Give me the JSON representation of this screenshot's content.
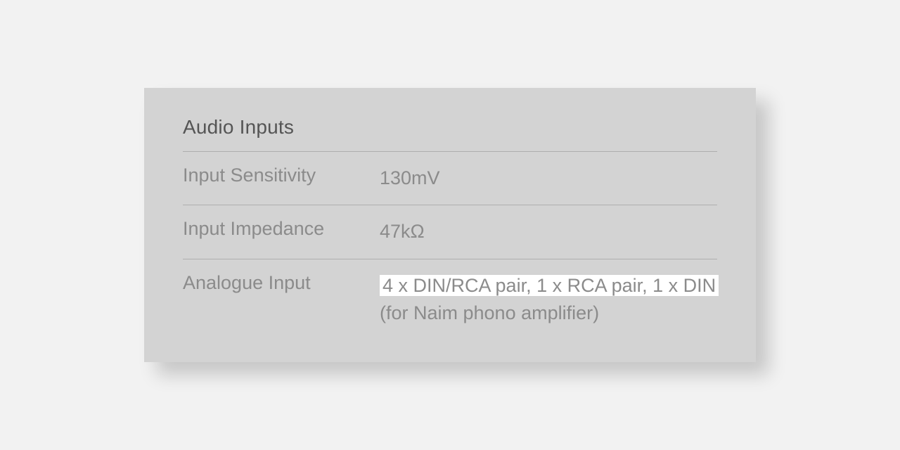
{
  "section": {
    "title": "Audio Inputs",
    "rows": [
      {
        "label": "Input Sensitivity",
        "value": "130mV"
      },
      {
        "label": "Input Impedance",
        "value": "47kΩ"
      },
      {
        "label": "Analogue Input",
        "value_highlight": "4 x DIN/RCA pair, 1 x RCA pair, 1 x DIN ",
        "value_rest": "(for Naim phono amplifier)"
      }
    ]
  }
}
